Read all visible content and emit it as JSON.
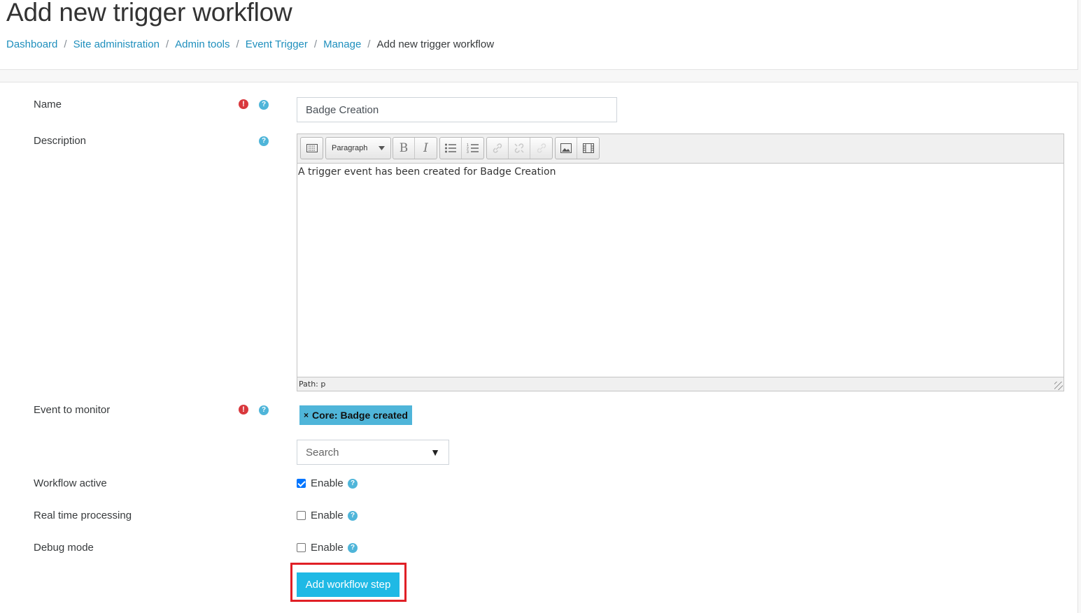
{
  "header": {
    "title": "Add new trigger workflow",
    "breadcrumb": [
      {
        "label": "Dashboard",
        "link": true
      },
      {
        "label": "Site administration",
        "link": true
      },
      {
        "label": "Admin tools",
        "link": true
      },
      {
        "label": "Event Trigger",
        "link": true
      },
      {
        "label": "Manage",
        "link": true
      },
      {
        "label": "Add new trigger workflow",
        "link": false
      }
    ],
    "separator": "/"
  },
  "form": {
    "name": {
      "label": "Name",
      "value": "Badge Creation",
      "required": true
    },
    "description": {
      "label": "Description",
      "format_select": "Paragraph",
      "content": "A trigger event has been created for Badge Creation",
      "path": "Path: p"
    },
    "event": {
      "label": "Event to monitor",
      "required": true,
      "selected_tag": "Core: Badge created",
      "tag_remove": "×",
      "search_placeholder": "Search",
      "dropdown_arrow": "▼"
    },
    "workflow_active": {
      "label": "Workflow active",
      "option": "Enable",
      "checked": true
    },
    "realtime": {
      "label": "Real time processing",
      "option": "Enable",
      "checked": false
    },
    "debug": {
      "label": "Debug mode",
      "option": "Enable",
      "checked": false
    },
    "submit_label": "Add workflow step"
  },
  "icons": {
    "required": "exclamation-circle-icon",
    "help": "question-circle-icon",
    "required_glyph": "!",
    "help_glyph": "?"
  },
  "colors": {
    "link": "#1f8fbd",
    "primary_button": "#1fb9e5",
    "tag": "#4fb5d9",
    "required": "#d9383d",
    "help": "#4fb5d9",
    "highlight": "#e01f26"
  }
}
